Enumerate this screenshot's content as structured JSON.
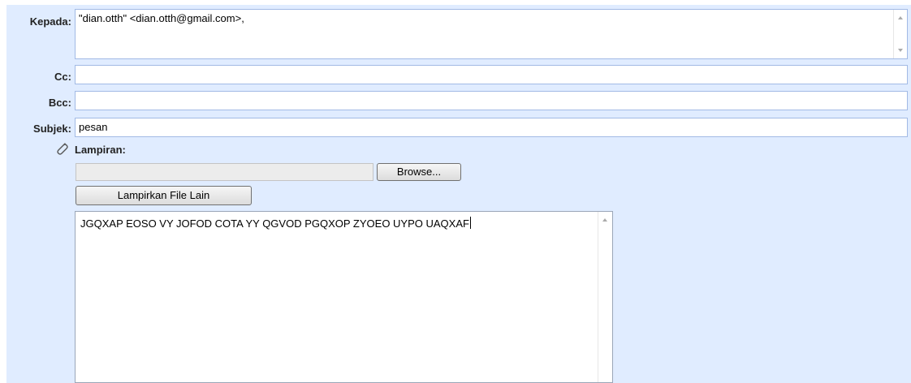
{
  "compose": {
    "to": {
      "label": "Kepada:",
      "value": "\"dian.otth\" <dian.otth@gmail.com>,"
    },
    "cc": {
      "label": "Cc:",
      "value": ""
    },
    "bcc": {
      "label": "Bcc:",
      "value": ""
    },
    "subject": {
      "label": "Subjek:",
      "value": "pesan"
    },
    "attachment": {
      "label": "Lampiran:",
      "icon": "paperclip-icon",
      "browse_label": "Browse...",
      "add_file_label": "Lampirkan File Lain"
    },
    "body": {
      "value": "JGQXAP EOSO VY JOFOD COTA YY QGVOD PGQXOP ZYOEO UYPO UAQXAF"
    }
  },
  "colors": {
    "panel": "#e0ecff",
    "field_border": "#a2bae5"
  }
}
